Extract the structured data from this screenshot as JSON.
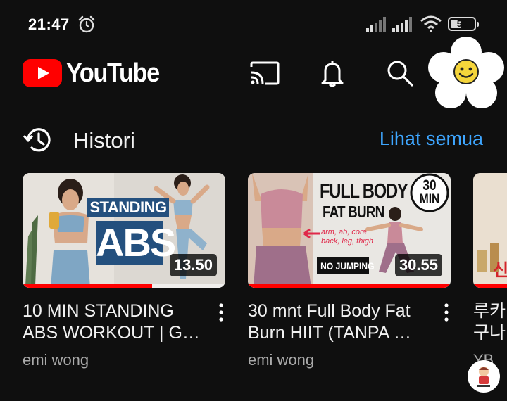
{
  "status_bar": {
    "time": "21:47",
    "battery": "53",
    "battery_level": 0.53
  },
  "header": {
    "logo_text": "YouTube",
    "cast_icon": "cast-icon",
    "notifications_icon": "bell-icon",
    "search_icon": "search-icon",
    "avatar": "flower-smiley-avatar"
  },
  "history_section": {
    "title": "Histori",
    "see_all": "Lihat semua",
    "icon": "history-icon"
  },
  "videos": [
    {
      "thumb_text_1": "STANDING",
      "thumb_text_2": "ABS",
      "duration": "13.50",
      "progress": 0.64,
      "title": "10 MIN STANDING ABS WORKOUT | G…",
      "channel": "emi wong"
    },
    {
      "thumb_text_1": "FULL BODY",
      "thumb_text_2": "FAT BURN",
      "thumb_badge_1": "30",
      "thumb_badge_2": "MIN",
      "thumb_note": "arm, ab, core back, leg, thigh",
      "thumb_tag": "NO JUMPING",
      "duration": "30.55",
      "progress": 1.0,
      "title": "30 mnt Full Body Fat Burn HIIT (TANPA …",
      "channel": "emi wong"
    },
    {
      "thumb_text_1": "신",
      "progress": 1.0,
      "title": "루카 구나",
      "channel": "YB"
    }
  ],
  "colors": {
    "background": "#0f0f0f",
    "brand_red": "#ff0000",
    "link_blue": "#3ea6ff",
    "secondary_text": "#aaaaaa"
  }
}
